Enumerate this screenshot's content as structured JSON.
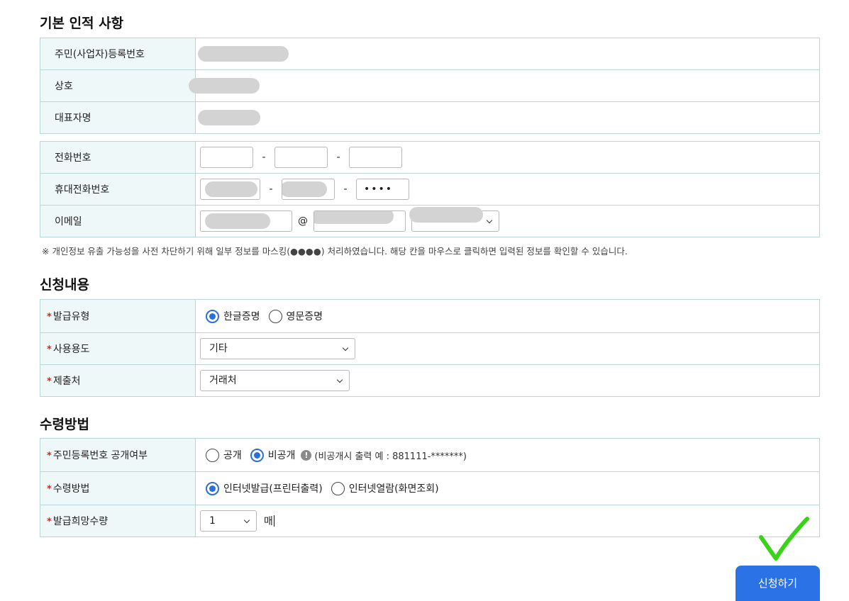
{
  "basic": {
    "title": "기본 인적 사항",
    "reg_number_label": "주민(사업자)등록번호",
    "company_label": "상호",
    "ceo_label": "대표자명"
  },
  "contact": {
    "phone_label": "전화번호",
    "phone_sep": "-",
    "mobile_label": "휴대전화번호",
    "mobile_last": "••••",
    "email_label": "이메일",
    "email_at": "@"
  },
  "notice": "※ 개인정보 유출 가능성을 사전 차단하기 위해 일부 정보를 마스킹(●●●●) 처리하였습니다. 해당 칸을 마우스로 클릭하면 입력된 정보를 확인할 수 있습니다.",
  "request": {
    "title": "신청내용",
    "required_mark": "*",
    "issue_type_label": "발급유형",
    "issue_type_options": [
      "한글증명",
      "영문증명"
    ],
    "issue_type_selected": "한글증명",
    "purpose_label": "사용용도",
    "purpose_value": "기타",
    "submit_to_label": "제출처",
    "submit_to_value": "거래처"
  },
  "receive": {
    "title": "수령방법",
    "disclosure_label": "주민등록번호 공개여부",
    "disclosure_options": [
      "공개",
      "비공개"
    ],
    "disclosure_selected": "비공개",
    "disclosure_info": "(비공개시 출력 예 : 881111-*******)",
    "method_label": "수령방법",
    "method_options": [
      "인터넷발급(프린터출력)",
      "인터넷열람(화면조회)"
    ],
    "method_selected": "인터넷발급(프린터출력)",
    "quantity_label": "발급희망수량",
    "quantity_value": "1",
    "quantity_unit": "매"
  },
  "submit_label": "신청하기",
  "colors": {
    "accent": "#2b72e6",
    "header_bg": "#eef8f8",
    "border": "#b9d6d9",
    "required": "#e2231a",
    "checkmark": "#39d31a"
  }
}
